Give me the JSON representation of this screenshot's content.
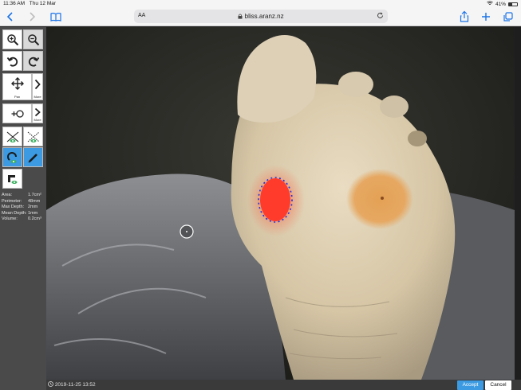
{
  "status_bar": {
    "time": "11:36 AM",
    "date": "Thu 12 Mar",
    "battery": "41%"
  },
  "browser": {
    "text_size_label": "AA",
    "url": "bliss.aranz.nz"
  },
  "tools": {
    "pan_label": "Pan",
    "more_label_1": "More",
    "more_label_2": "More"
  },
  "measurements": [
    {
      "label": "Area:",
      "value": "1.7cm²"
    },
    {
      "label": "Perimeter:",
      "value": "48mm"
    },
    {
      "label": "Max Depth:",
      "value": "2mm"
    },
    {
      "label": "Mean Depth:",
      "value": "1mm"
    },
    {
      "label": "Volume:",
      "value": "0.2cm³"
    }
  ],
  "footer": {
    "timestamp": "2019-11-25 13:52",
    "accept_label": "Accept",
    "cancel_label": "Cancel"
  },
  "colors": {
    "accent": "#3b9ae1",
    "outline": "#1f2fe0",
    "wound": "#ff3b2b"
  }
}
